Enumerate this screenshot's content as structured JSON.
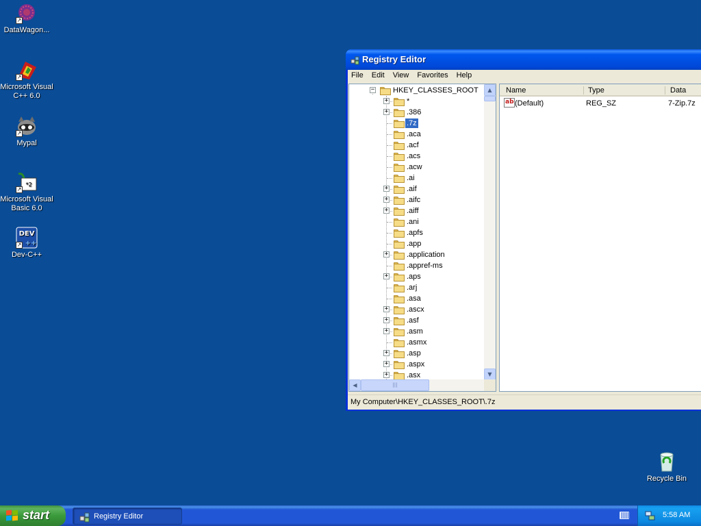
{
  "desktop": {
    "icons": [
      {
        "label": "DataWagon...",
        "icon": "datawagon-icon"
      },
      {
        "label": "Microsoft Visual C++ 6.0",
        "icon": "visual-cpp-icon"
      },
      {
        "label": "Mypal",
        "icon": "mypal-icon"
      },
      {
        "label": "Microsoft Visual Basic 6.0",
        "icon": "visual-basic-icon"
      },
      {
        "label": "Dev-C++",
        "icon": "devcpp-icon"
      },
      {
        "label": "Recycle Bin",
        "icon": "recycle-bin-icon"
      }
    ]
  },
  "window": {
    "title": "Registry Editor",
    "menu": [
      "File",
      "Edit",
      "View",
      "Favorites",
      "Help"
    ],
    "tree": {
      "root": "HKEY_CLASSES_ROOT",
      "items": [
        {
          "label": "*",
          "expandable": true
        },
        {
          "label": ".386",
          "expandable": true
        },
        {
          "label": ".7z",
          "expandable": false,
          "selected": true
        },
        {
          "label": ".aca",
          "expandable": false
        },
        {
          "label": ".acf",
          "expandable": false
        },
        {
          "label": ".acs",
          "expandable": false
        },
        {
          "label": ".acw",
          "expandable": false
        },
        {
          "label": ".ai",
          "expandable": false
        },
        {
          "label": ".aif",
          "expandable": true
        },
        {
          "label": ".aifc",
          "expandable": true
        },
        {
          "label": ".aiff",
          "expandable": true
        },
        {
          "label": ".ani",
          "expandable": false
        },
        {
          "label": ".apfs",
          "expandable": false
        },
        {
          "label": ".app",
          "expandable": false
        },
        {
          "label": ".application",
          "expandable": true
        },
        {
          "label": ".appref-ms",
          "expandable": false
        },
        {
          "label": ".aps",
          "expandable": true
        },
        {
          "label": ".arj",
          "expandable": false
        },
        {
          "label": ".asa",
          "expandable": false
        },
        {
          "label": ".ascx",
          "expandable": true
        },
        {
          "label": ".asf",
          "expandable": true
        },
        {
          "label": ".asm",
          "expandable": true
        },
        {
          "label": ".asmx",
          "expandable": false
        },
        {
          "label": ".asp",
          "expandable": true
        },
        {
          "label": ".aspx",
          "expandable": true
        },
        {
          "label": ".asx",
          "expandable": true
        }
      ]
    },
    "list": {
      "columns": [
        "Name",
        "Type",
        "Data"
      ],
      "rows": [
        {
          "name": "(Default)",
          "type": "REG_SZ",
          "data": "7-Zip.7z",
          "icon": "string-value-icon"
        }
      ]
    },
    "status": "My Computer\\HKEY_CLASSES_ROOT\\.7z"
  },
  "taskbar": {
    "start_label": "start",
    "tasks": [
      {
        "label": "Registry Editor"
      }
    ],
    "clock": "5:58 AM"
  },
  "colors": {
    "desktop": "#0a4c96",
    "selection": "#316ac5",
    "titlebar": "#0058ee",
    "start": "#3a9a3a"
  }
}
